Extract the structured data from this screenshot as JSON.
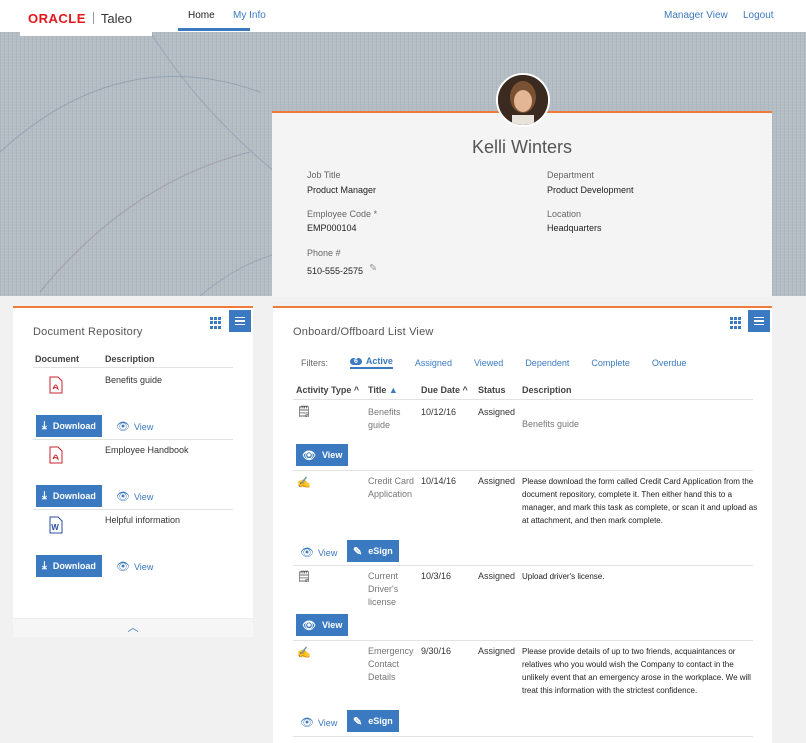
{
  "brand": {
    "oracle": "ORACLE",
    "product": "Taleo"
  },
  "nav": {
    "home": "Home",
    "my_info": "My Info",
    "manager_view": "Manager View",
    "logout": "Logout"
  },
  "profile": {
    "name": "Kelli Winters",
    "job_title_label": "Job Title",
    "job_title": "Product Manager",
    "department_label": "Department",
    "department": "Product Development",
    "employee_code_label": "Employee Code",
    "employee_code_required": "*",
    "employee_code": "EMP000104",
    "location_label": "Location",
    "location": "Headquarters",
    "phone_label": "Phone #",
    "phone": "510-555-2575"
  },
  "documents": {
    "title": "Document Repository",
    "col_document": "Document",
    "col_description": "Description",
    "download_label": "Download",
    "view_label": "View",
    "items": [
      {
        "type": "pdf",
        "description": "Benefits guide"
      },
      {
        "type": "pdf",
        "description": "Employee Handbook"
      },
      {
        "type": "word",
        "description": "Helpful information"
      }
    ]
  },
  "onboard": {
    "title": "Onboard/Offboard List View",
    "filters_label": "Filters:",
    "active_count": "6",
    "filters": [
      "Active",
      "Assigned",
      "Viewed",
      "Dependent",
      "Complete",
      "Overdue"
    ],
    "columns": [
      "Activity Type",
      "Title",
      "Due Date",
      "Status",
      "Description"
    ],
    "view_label": "View",
    "esign_label": "eSign",
    "rows": [
      {
        "title_lines": [
          "Benefits",
          "guide"
        ],
        "due": "10/12/16",
        "status": "Assigned",
        "description_lines": [
          "Benefits guide"
        ]
      },
      {
        "title_lines": [
          "Credit Card",
          "Application"
        ],
        "due": "10/14/16",
        "status": "Assigned",
        "description_lines": [
          "Please download the form called Credit Card Application from the",
          "document repository, complete it. Then either hand this to a",
          "manager, and mark this task as complete, or scan it and upload as",
          "at attachment, and then mark complete."
        ]
      },
      {
        "title_lines": [
          "Current",
          "Driver's",
          "license"
        ],
        "due": "10/3/16",
        "status": "Assigned",
        "description_lines": [
          "Upload driver's license."
        ]
      },
      {
        "title_lines": [
          "Emergency",
          "Contact",
          "Details"
        ],
        "due": "9/30/16",
        "status": "Assigned",
        "description_lines": [
          "Please provide details of up to two friends, acquaintances or",
          "relatives who you would wish the Company to contact in the",
          "unlikely event that an emergency arose in the workplace. We will",
          "treat this information with the strictest confidence."
        ]
      }
    ]
  },
  "colors": {
    "accent": "#3b7ac0",
    "highlight": "#f07a3a",
    "brand_red": "#e4161c"
  },
  "icons": [
    "grid-icon",
    "menu-icon",
    "pdf-icon",
    "word-icon",
    "download-icon",
    "eye-icon",
    "edit-icon",
    "form-icon",
    "esign-icon",
    "chevron-up-icon",
    "pencil-icon",
    "sort-asc-icon"
  ]
}
